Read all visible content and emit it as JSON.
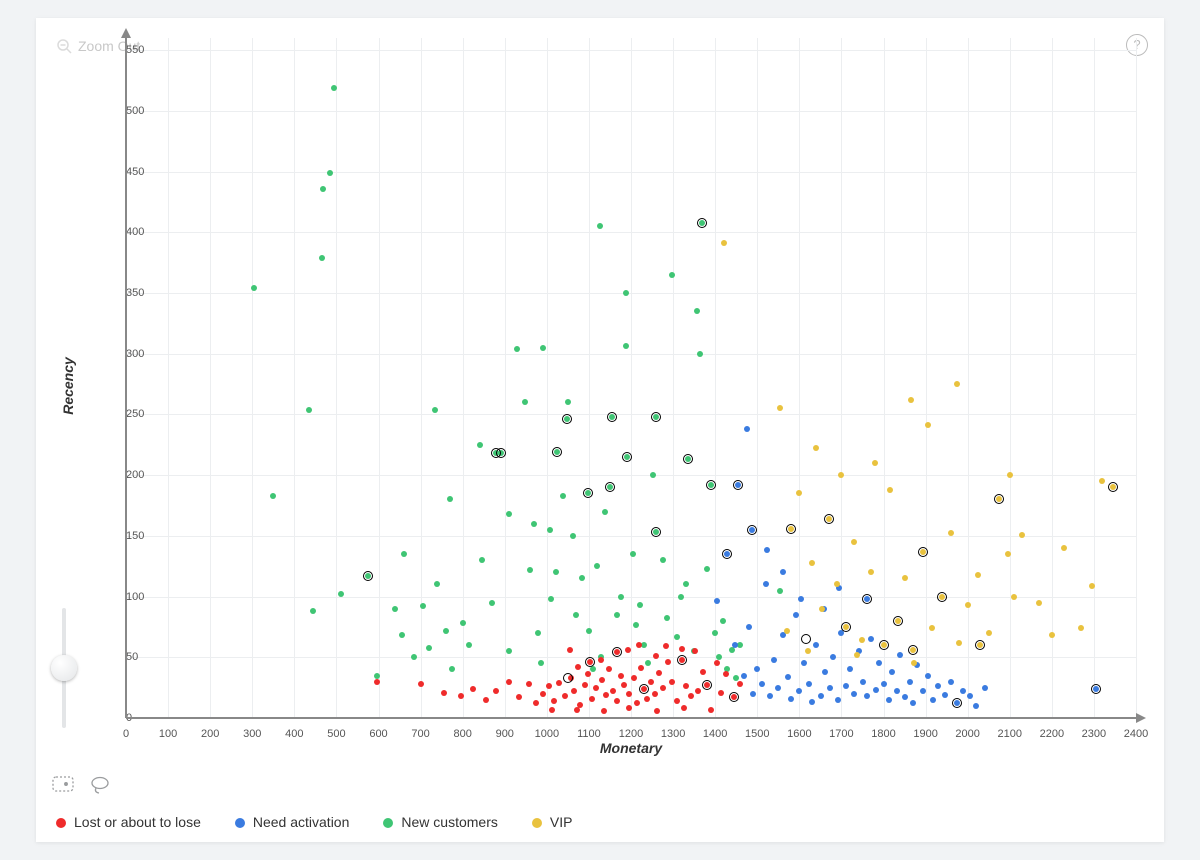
{
  "ui": {
    "zoom_out_label": "Zoom Out",
    "help_tooltip": "?"
  },
  "chart_data": {
    "type": "scatter",
    "xlabel": "Monetary",
    "ylabel": "Recency",
    "xlim": [
      0,
      2400
    ],
    "ylim": [
      0,
      560
    ],
    "x_ticks": [
      0,
      100,
      200,
      300,
      400,
      500,
      600,
      700,
      800,
      900,
      1000,
      1100,
      1200,
      1300,
      1400,
      1500,
      1600,
      1700,
      1800,
      1900,
      2000,
      2100,
      2200,
      2300,
      2400
    ],
    "y_ticks": [
      0,
      50,
      100,
      150,
      200,
      250,
      300,
      350,
      400,
      450,
      500,
      550
    ],
    "grid": true,
    "series_meta": [
      {
        "key": "lost",
        "name": "Lost or about to lose",
        "color": "#ef2b2b"
      },
      {
        "key": "need",
        "name": "Need activation",
        "color": "#3a7be0"
      },
      {
        "key": "new",
        "name": "New customers",
        "color": "#3fc574"
      },
      {
        "key": "vip",
        "name": "VIP",
        "color": "#e9c23e"
      }
    ],
    "series": {
      "new": [
        [
          305,
          354
        ],
        [
          350,
          183
        ],
        [
          435,
          254
        ],
        [
          465,
          379
        ],
        [
          485,
          449
        ],
        [
          467,
          436
        ],
        [
          494,
          519
        ],
        [
          575,
          117
        ],
        [
          597,
          35
        ],
        [
          735,
          254
        ],
        [
          880,
          218
        ],
        [
          890,
          218
        ],
        [
          910,
          168
        ],
        [
          928,
          304
        ],
        [
          947,
          260
        ],
        [
          960,
          122
        ],
        [
          970,
          160
        ],
        [
          985,
          45
        ],
        [
          1008,
          155
        ],
        [
          1022,
          120
        ],
        [
          1025,
          219
        ],
        [
          1038,
          183
        ],
        [
          1047,
          246
        ],
        [
          1050,
          260
        ],
        [
          1062,
          150
        ],
        [
          1070,
          85
        ],
        [
          1083,
          115
        ],
        [
          1098,
          185
        ],
        [
          1100,
          72
        ],
        [
          1110,
          40
        ],
        [
          1120,
          125
        ],
        [
          1128,
          50
        ],
        [
          1138,
          170
        ],
        [
          1150,
          190
        ],
        [
          1155,
          248
        ],
        [
          1167,
          85
        ],
        [
          1176,
          100
        ],
        [
          1188,
          306
        ],
        [
          1190,
          215
        ],
        [
          1205,
          135
        ],
        [
          1212,
          77
        ],
        [
          1222,
          93
        ],
        [
          1230,
          60
        ],
        [
          1240,
          45
        ],
        [
          1252,
          200
        ],
        [
          1260,
          153
        ],
        [
          1276,
          130
        ],
        [
          1285,
          82
        ],
        [
          1298,
          365
        ],
        [
          1310,
          67
        ],
        [
          1318,
          100
        ],
        [
          1330,
          110
        ],
        [
          1126,
          405
        ],
        [
          1350,
          55
        ],
        [
          1358,
          335
        ],
        [
          1365,
          300
        ],
        [
          1368,
          408
        ],
        [
          1380,
          123
        ],
        [
          1390,
          192
        ],
        [
          1400,
          70
        ],
        [
          1410,
          50
        ],
        [
          1418,
          80
        ],
        [
          1428,
          40
        ],
        [
          1440,
          56
        ],
        [
          1450,
          33
        ],
        [
          1460,
          60
        ],
        [
          980,
          70
        ],
        [
          910,
          55
        ],
        [
          870,
          95
        ],
        [
          845,
          130
        ],
        [
          815,
          60
        ],
        [
          800,
          78
        ],
        [
          775,
          40
        ],
        [
          760,
          72
        ],
        [
          740,
          110
        ],
        [
          720,
          58
        ],
        [
          705,
          92
        ],
        [
          685,
          50
        ],
        [
          660,
          135
        ],
        [
          655,
          68
        ],
        [
          640,
          90
        ],
        [
          1010,
          98
        ],
        [
          1335,
          213
        ],
        [
          1260,
          248
        ],
        [
          1187,
          350
        ],
        [
          770,
          180
        ],
        [
          840,
          225
        ],
        [
          990,
          305
        ],
        [
          1555,
          105
        ],
        [
          445,
          88
        ],
        [
          510,
          102
        ]
      ],
      "lost": [
        [
          596,
          30
        ],
        [
          700,
          28
        ],
        [
          755,
          21
        ],
        [
          795,
          18
        ],
        [
          825,
          24
        ],
        [
          855,
          15
        ],
        [
          880,
          22
        ],
        [
          910,
          30
        ],
        [
          935,
          17
        ],
        [
          958,
          28
        ],
        [
          975,
          12
        ],
        [
          990,
          20
        ],
        [
          1005,
          26
        ],
        [
          1018,
          14
        ],
        [
          1030,
          29
        ],
        [
          1044,
          18
        ],
        [
          1058,
          33
        ],
        [
          1065,
          22
        ],
        [
          1078,
          11
        ],
        [
          1090,
          27
        ],
        [
          1098,
          36
        ],
        [
          1108,
          16
        ],
        [
          1118,
          25
        ],
        [
          1132,
          31
        ],
        [
          1140,
          19
        ],
        [
          1148,
          40
        ],
        [
          1158,
          22
        ],
        [
          1166,
          14
        ],
        [
          1176,
          35
        ],
        [
          1184,
          27
        ],
        [
          1196,
          20
        ],
        [
          1208,
          33
        ],
        [
          1214,
          12
        ],
        [
          1224,
          41
        ],
        [
          1230,
          24
        ],
        [
          1238,
          16
        ],
        [
          1248,
          30
        ],
        [
          1258,
          20
        ],
        [
          1266,
          37
        ],
        [
          1276,
          25
        ],
        [
          1288,
          46
        ],
        [
          1298,
          30
        ],
        [
          1310,
          14
        ],
        [
          1320,
          48
        ],
        [
          1330,
          26
        ],
        [
          1342,
          18
        ],
        [
          1352,
          55
        ],
        [
          1360,
          22
        ],
        [
          1370,
          38
        ],
        [
          1380,
          27
        ],
        [
          1404,
          45
        ],
        [
          1415,
          21
        ],
        [
          1426,
          36
        ],
        [
          1445,
          17
        ],
        [
          1460,
          28
        ],
        [
          1012,
          7
        ],
        [
          1072,
          7
        ],
        [
          1136,
          6
        ],
        [
          1195,
          8
        ],
        [
          1262,
          6
        ],
        [
          1327,
          8
        ],
        [
          1390,
          7
        ],
        [
          1056,
          56
        ],
        [
          1194,
          56
        ],
        [
          1320,
          57
        ],
        [
          1128,
          48
        ],
        [
          1260,
          51
        ],
        [
          1073,
          42
        ],
        [
          1220,
          60
        ],
        [
          1284,
          59
        ],
        [
          1166,
          54
        ],
        [
          1102,
          46
        ]
      ],
      "need": [
        [
          1405,
          96
        ],
        [
          1428,
          135
        ],
        [
          1448,
          60
        ],
        [
          1455,
          192
        ],
        [
          1468,
          35
        ],
        [
          1480,
          75
        ],
        [
          1490,
          20
        ],
        [
          1500,
          40
        ],
        [
          1512,
          28
        ],
        [
          1520,
          110
        ],
        [
          1530,
          18
        ],
        [
          1540,
          48
        ],
        [
          1550,
          25
        ],
        [
          1562,
          68
        ],
        [
          1572,
          34
        ],
        [
          1580,
          16
        ],
        [
          1592,
          85
        ],
        [
          1600,
          22
        ],
        [
          1610,
          45
        ],
        [
          1622,
          28
        ],
        [
          1630,
          13
        ],
        [
          1640,
          60
        ],
        [
          1652,
          18
        ],
        [
          1662,
          38
        ],
        [
          1672,
          25
        ],
        [
          1680,
          50
        ],
        [
          1692,
          15
        ],
        [
          1700,
          70
        ],
        [
          1712,
          26
        ],
        [
          1720,
          40
        ],
        [
          1730,
          20
        ],
        [
          1742,
          55
        ],
        [
          1752,
          30
        ],
        [
          1760,
          18
        ],
        [
          1770,
          65
        ],
        [
          1782,
          23
        ],
        [
          1790,
          45
        ],
        [
          1800,
          28
        ],
        [
          1812,
          15
        ],
        [
          1820,
          38
        ],
        [
          1832,
          22
        ],
        [
          1840,
          52
        ],
        [
          1850,
          17
        ],
        [
          1862,
          30
        ],
        [
          1870,
          12
        ],
        [
          1880,
          44
        ],
        [
          1895,
          22
        ],
        [
          1905,
          35
        ],
        [
          1918,
          15
        ],
        [
          1930,
          26
        ],
        [
          1945,
          19
        ],
        [
          1960,
          30
        ],
        [
          1975,
          12
        ],
        [
          1990,
          22
        ],
        [
          2005,
          18
        ],
        [
          2020,
          10
        ],
        [
          2040,
          25
        ],
        [
          1488,
          155
        ],
        [
          1522,
          138
        ],
        [
          1560,
          120
        ],
        [
          1604,
          98
        ],
        [
          1658,
          90
        ],
        [
          1695,
          107
        ],
        [
          1760,
          98
        ],
        [
          1476,
          238
        ],
        [
          2305,
          24
        ]
      ],
      "vip": [
        [
          1420,
          391
        ],
        [
          1580,
          156
        ],
        [
          1600,
          185
        ],
        [
          1630,
          128
        ],
        [
          1655,
          90
        ],
        [
          1670,
          164
        ],
        [
          1690,
          110
        ],
        [
          1710,
          75
        ],
        [
          1730,
          145
        ],
        [
          1750,
          64
        ],
        [
          1770,
          120
        ],
        [
          1800,
          60
        ],
        [
          1815,
          188
        ],
        [
          1835,
          80
        ],
        [
          1850,
          115
        ],
        [
          1870,
          56
        ],
        [
          1895,
          137
        ],
        [
          1915,
          74
        ],
        [
          1940,
          100
        ],
        [
          1960,
          152
        ],
        [
          1980,
          62
        ],
        [
          2000,
          93
        ],
        [
          2025,
          118
        ],
        [
          2050,
          70
        ],
        [
          2075,
          180
        ],
        [
          2095,
          135
        ],
        [
          2110,
          100
        ],
        [
          2130,
          151
        ],
        [
          2170,
          95
        ],
        [
          2200,
          68
        ],
        [
          2230,
          140
        ],
        [
          2270,
          74
        ],
        [
          2295,
          109
        ],
        [
          2320,
          195
        ],
        [
          1905,
          241
        ],
        [
          1865,
          262
        ],
        [
          1975,
          275
        ],
        [
          2100,
          200
        ],
        [
          1780,
          210
        ],
        [
          1700,
          200
        ],
        [
          1640,
          222
        ],
        [
          1555,
          255
        ],
        [
          2345,
          190
        ],
        [
          2030,
          60
        ],
        [
          1872,
          45
        ],
        [
          1738,
          52
        ],
        [
          1620,
          55
        ],
        [
          1570,
          72
        ]
      ]
    },
    "selected_points": [
      {
        "x": 575,
        "y": 117
      },
      {
        "x": 880,
        "y": 218
      },
      {
        "x": 890,
        "y": 218
      },
      {
        "x": 1025,
        "y": 219
      },
      {
        "x": 1047,
        "y": 246
      },
      {
        "x": 1098,
        "y": 185
      },
      {
        "x": 1150,
        "y": 190
      },
      {
        "x": 1155,
        "y": 248
      },
      {
        "x": 1260,
        "y": 153
      },
      {
        "x": 1190,
        "y": 215
      },
      {
        "x": 1335,
        "y": 213
      },
      {
        "x": 1260,
        "y": 248
      },
      {
        "x": 1368,
        "y": 408
      },
      {
        "x": 1390,
        "y": 192
      },
      {
        "x": 1580,
        "y": 156
      },
      {
        "x": 1615,
        "y": 65
      },
      {
        "x": 1670,
        "y": 164
      },
      {
        "x": 1710,
        "y": 75
      },
      {
        "x": 1760,
        "y": 98
      },
      {
        "x": 1800,
        "y": 60
      },
      {
        "x": 1835,
        "y": 80
      },
      {
        "x": 1870,
        "y": 56
      },
      {
        "x": 1895,
        "y": 137
      },
      {
        "x": 1940,
        "y": 100
      },
      {
        "x": 1975,
        "y": 12
      },
      {
        "x": 2030,
        "y": 60
      },
      {
        "x": 2075,
        "y": 180
      },
      {
        "x": 2305,
        "y": 24
      },
      {
        "x": 2345,
        "y": 190
      },
      {
        "x": 1428,
        "y": 135
      },
      {
        "x": 1455,
        "y": 192
      },
      {
        "x": 1488,
        "y": 155
      },
      {
        "x": 1050,
        "y": 33
      },
      {
        "x": 1102,
        "y": 46
      },
      {
        "x": 1166,
        "y": 54
      },
      {
        "x": 1230,
        "y": 24
      },
      {
        "x": 1320,
        "y": 48
      },
      {
        "x": 1380,
        "y": 27
      },
      {
        "x": 1445,
        "y": 17
      }
    ]
  }
}
